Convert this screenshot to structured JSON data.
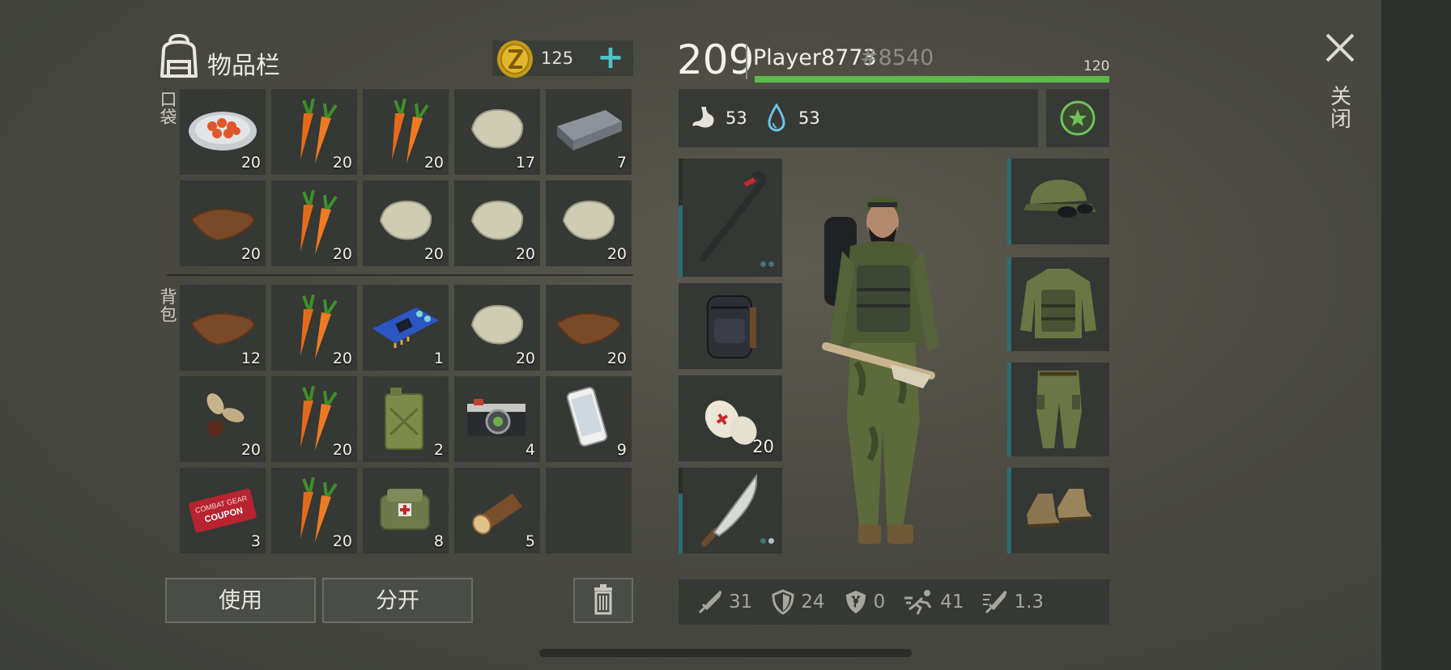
{
  "inventory": {
    "title": "物品栏",
    "coins": "125",
    "pocket_label": "口袋",
    "backpack_label": "背包",
    "pocket_items": [
      {
        "icon": "stew-plate-icon",
        "count": "20"
      },
      {
        "icon": "carrot-icon",
        "count": "20"
      },
      {
        "icon": "carrot-icon",
        "count": "20"
      },
      {
        "icon": "stone-icon",
        "count": "17"
      },
      {
        "icon": "iron-bar-icon",
        "count": "7"
      },
      {
        "icon": "leather-icon",
        "count": "20"
      },
      {
        "icon": "carrot-icon",
        "count": "20"
      },
      {
        "icon": "stone-icon",
        "count": "20"
      },
      {
        "icon": "stone-icon",
        "count": "20"
      },
      {
        "icon": "stone-icon",
        "count": "20"
      }
    ],
    "backpack_items": [
      {
        "icon": "leather-icon",
        "count": "12"
      },
      {
        "icon": "carrot-icon",
        "count": "20"
      },
      {
        "icon": "circuit-board-icon",
        "count": "1"
      },
      {
        "icon": "stone-icon",
        "count": "20"
      },
      {
        "icon": "leather-icon",
        "count": "20"
      },
      {
        "icon": "seeds-icon",
        "count": "20"
      },
      {
        "icon": "carrot-icon",
        "count": "20"
      },
      {
        "icon": "jerrycan-icon",
        "count": "2"
      },
      {
        "icon": "camera-icon",
        "count": "4"
      },
      {
        "icon": "smartphone-icon",
        "count": "9"
      },
      {
        "icon": "coupon-icon",
        "count": "3",
        "text_line1": "COMBAT GEAR",
        "text_line2": "COUPON"
      },
      {
        "icon": "carrot-icon",
        "count": "20"
      },
      {
        "icon": "medkit-bag-icon",
        "count": "8"
      },
      {
        "icon": "log-icon",
        "count": "5"
      },
      {
        "icon": "",
        "count": ""
      }
    ],
    "use_label": "使用",
    "split_label": "分开"
  },
  "player": {
    "level": "209",
    "name": "Player8773",
    "tag": "#8540",
    "xp_max": "120",
    "xp_fraction": 1.0,
    "hunger": "53",
    "thirst": "53"
  },
  "equipment": {
    "weapon": {
      "icon": "crowbar-icon",
      "durability_fraction": 0.6
    },
    "backpack": {
      "icon": "tactical-backpack-icon"
    },
    "consumable": {
      "icon": "bandage-icon",
      "count": "20"
    },
    "melee": {
      "icon": "machete-icon",
      "durability_fraction": 0.7
    },
    "head": {
      "icon": "camo-cap-icon",
      "durability_fraction": 1.0
    },
    "torso": {
      "icon": "camo-vest-icon",
      "durability_fraction": 1.0
    },
    "legs": {
      "icon": "camo-pants-icon",
      "durability_fraction": 1.0
    },
    "feet": {
      "icon": "boots-icon",
      "durability_fraction": 1.0
    }
  },
  "stats": [
    {
      "icon": "sword-icon",
      "value": "31"
    },
    {
      "icon": "shield-icon",
      "value": "24"
    },
    {
      "icon": "radiation-shield-icon",
      "value": "0"
    },
    {
      "icon": "running-icon",
      "value": "41"
    },
    {
      "icon": "attack-speed-icon",
      "value": "1.3"
    }
  ],
  "close_label": "关闭",
  "colors": {
    "accent": "#4ec2c8",
    "xp_bar": "#5db94a",
    "slot_bg": "#353834"
  }
}
